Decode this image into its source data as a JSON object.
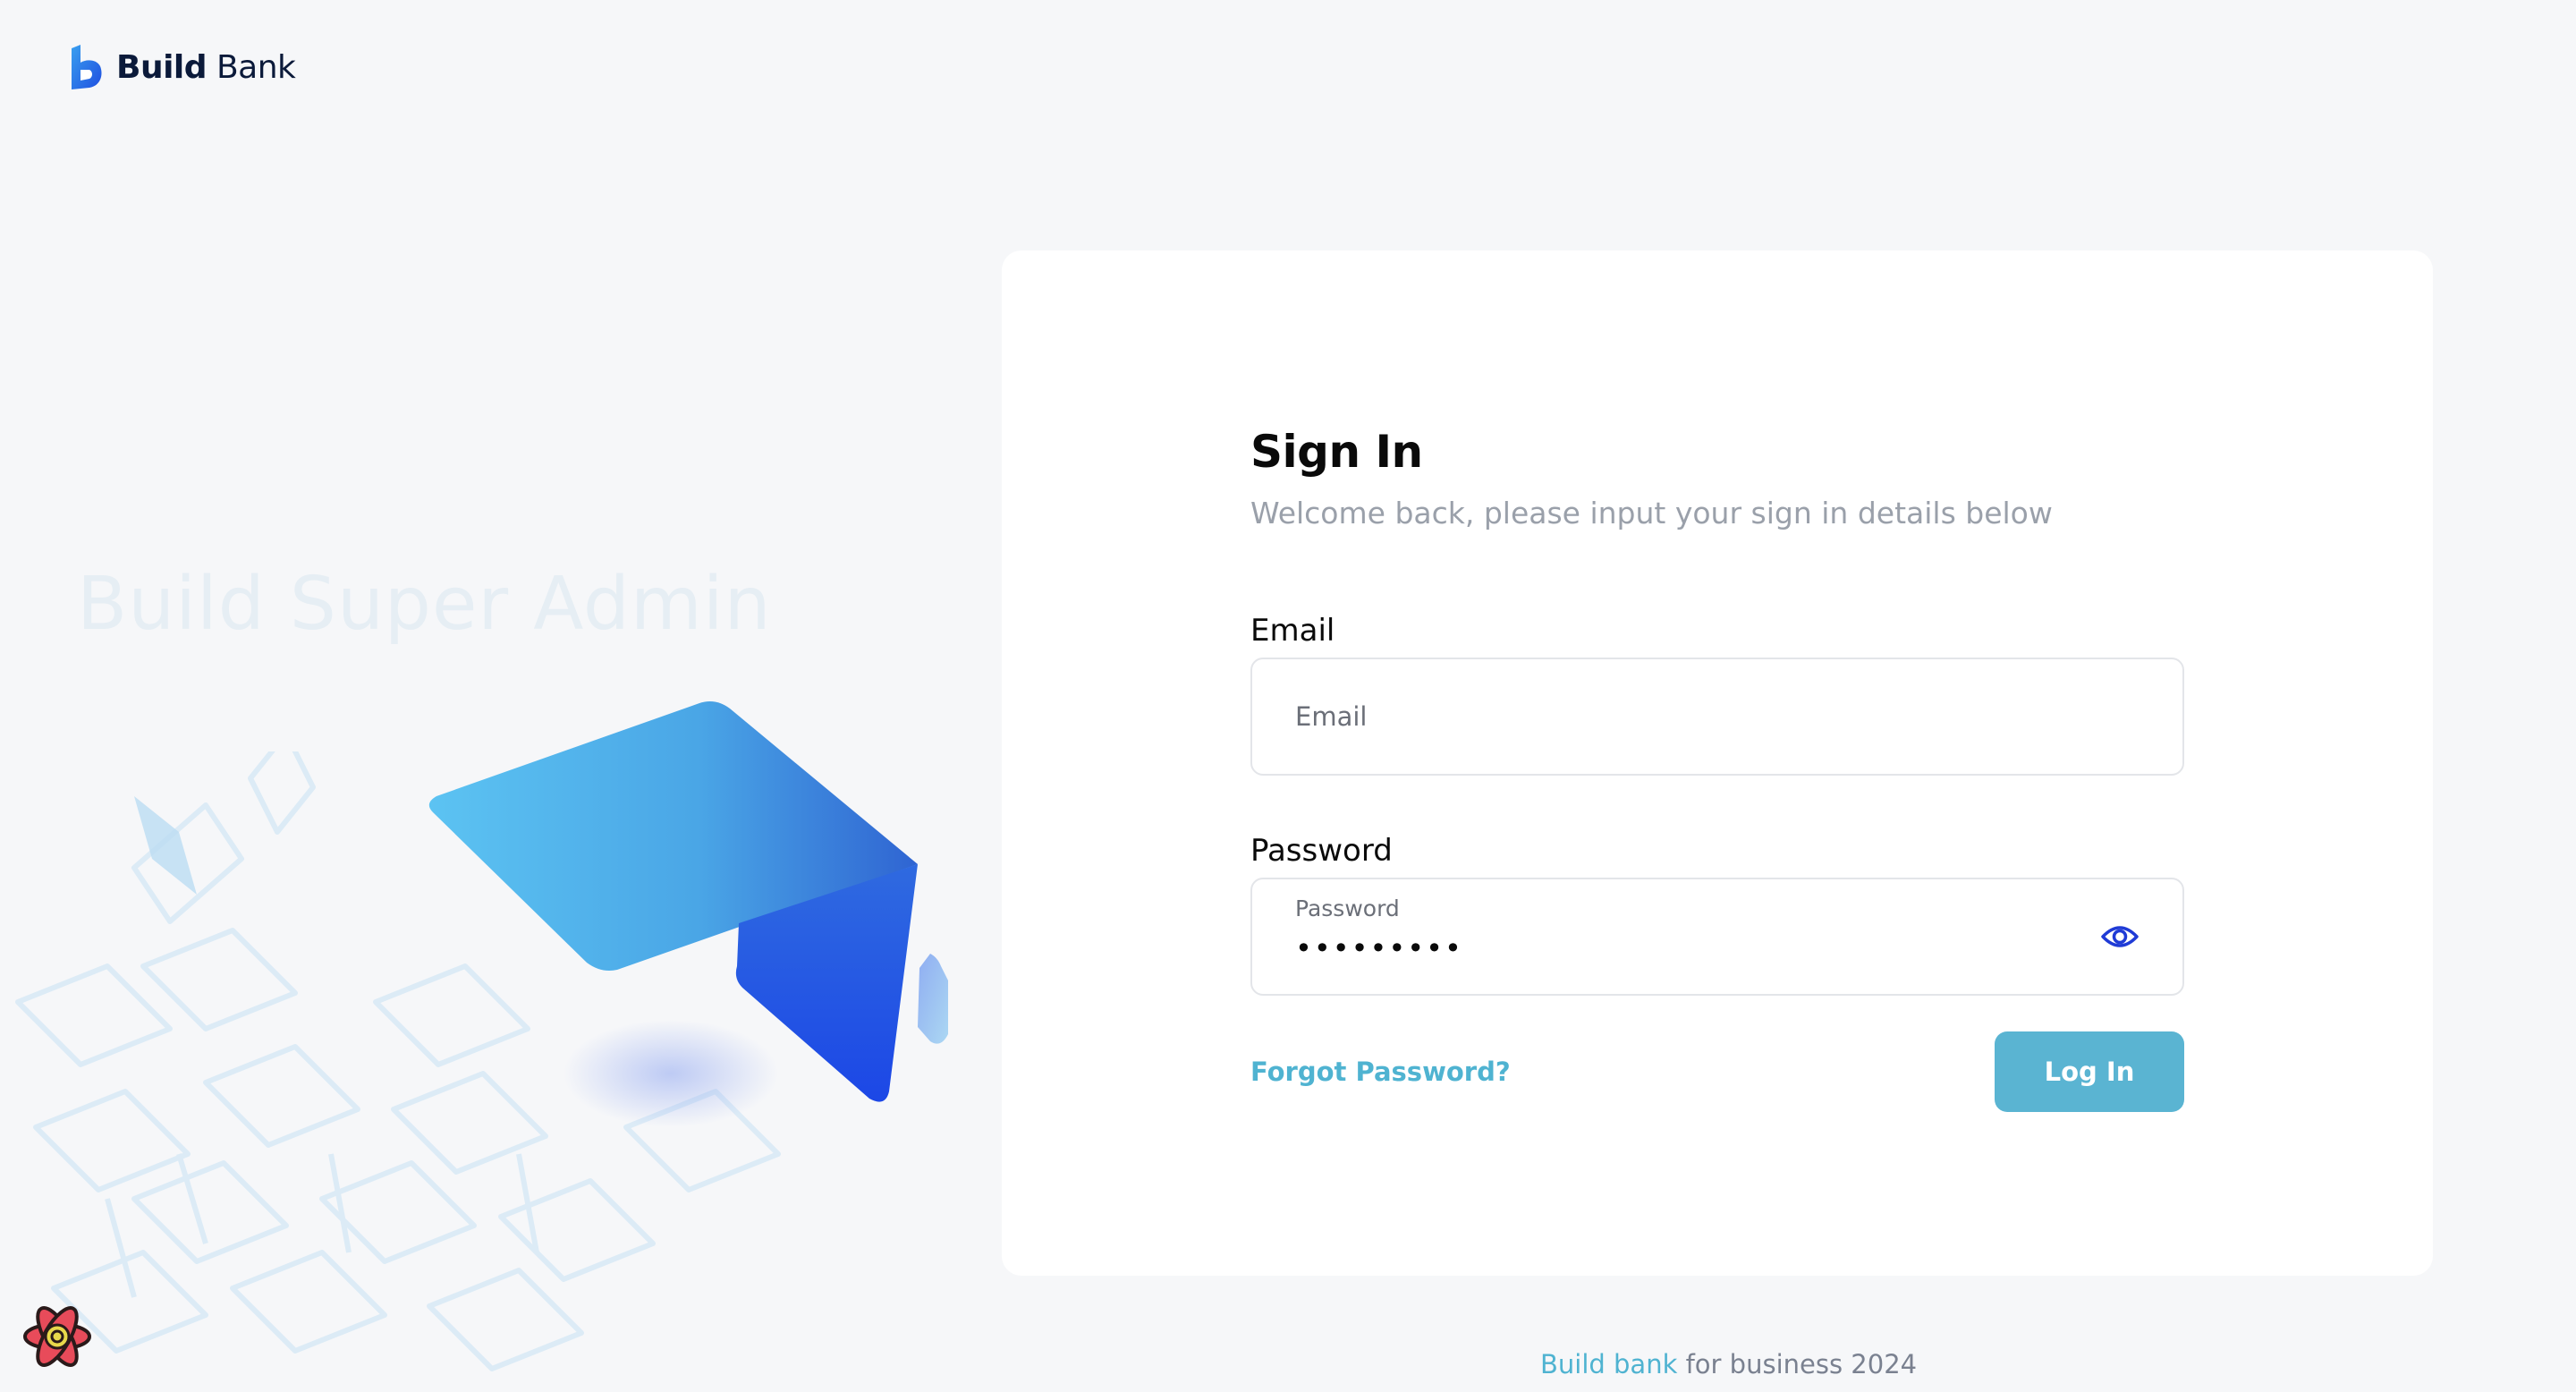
{
  "brand": {
    "name_bold": "Build",
    "name_regular": "Bank",
    "accent": "#2f6fe0"
  },
  "left_panel": {
    "title": "Build Super Admin"
  },
  "signin": {
    "title": "Sign In",
    "subtitle": "Welcome back, please input your sign in details below",
    "email": {
      "label": "Email",
      "placeholder": "Email",
      "value": ""
    },
    "password": {
      "label": "Password",
      "caption": "Password",
      "masked_value": "•••••••••",
      "toggle_icon": "eye-icon"
    },
    "forgot_link": "Forgot Password?",
    "login_button": "Log In"
  },
  "footer": {
    "brand": "Build bank",
    "text": " for business 2024"
  },
  "colors": {
    "background": "#f6f7f9",
    "card": "#ffffff",
    "primary": "#5ab4d2",
    "link": "#4fb3d1",
    "eye_icon": "#1f3bd6"
  }
}
